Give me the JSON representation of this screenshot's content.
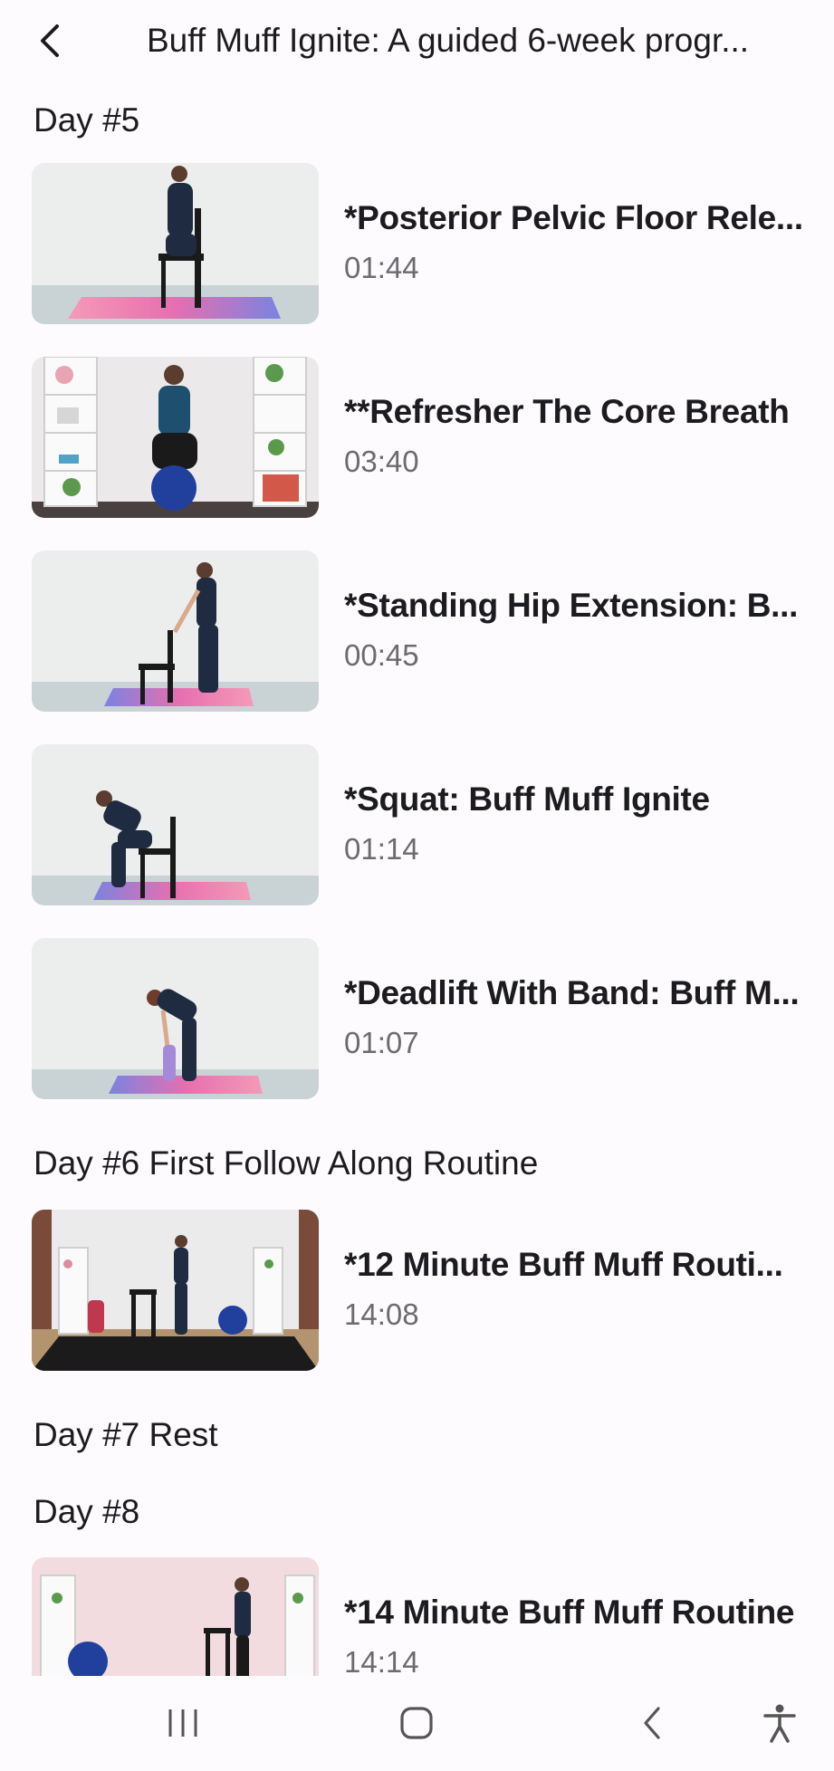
{
  "header": {
    "title": "Buff Muff Ignite: A guided 6-week progr..."
  },
  "sections": [
    {
      "day": "Day #5",
      "videos": [
        {
          "title": "*Posterior Pelvic Floor Rele...",
          "duration": "01:44"
        },
        {
          "title": "**Refresher The Core Breath",
          "duration": "03:40"
        },
        {
          "title": "*Standing Hip Extension: B...",
          "duration": "00:45"
        },
        {
          "title": "*Squat: Buff Muff Ignite",
          "duration": "01:14"
        },
        {
          "title": "*Deadlift With Band: Buff M...",
          "duration": "01:07"
        }
      ]
    },
    {
      "day": "Day #6 First Follow Along Routine",
      "videos": [
        {
          "title": "*12 Minute Buff Muff Routi...",
          "duration": "14:08"
        }
      ]
    },
    {
      "day": "Day #7 Rest",
      "videos": []
    },
    {
      "day": "Day #8",
      "videos": [
        {
          "title": "*14 Minute Buff Muff Routine",
          "duration": "14:14"
        }
      ]
    }
  ],
  "navbar": {
    "icons": [
      "recent-apps-icon",
      "home-icon",
      "back-icon",
      "accessibility-icon"
    ]
  },
  "colors": {
    "background": "#fdfbfd",
    "text": "#1c1b1f",
    "secondary_text": "#6d6a70",
    "mat_pink": "#f06a9c",
    "mat_blue": "#7a83e0",
    "outfit_navy": "#1f2b40"
  }
}
